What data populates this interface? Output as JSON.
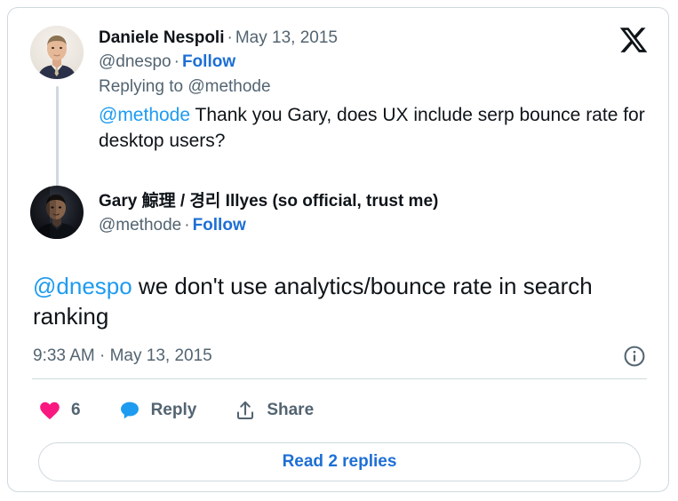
{
  "card": {
    "brand_logo": "x-logo",
    "border_color": "#cfd9de"
  },
  "parent_tweet": {
    "author": {
      "display_name": "Daniele Nespoli",
      "handle": "@dnespo",
      "avatar": "daniele-nespoli-avatar"
    },
    "separator": "·",
    "date": "May 13, 2015",
    "follow_label": "Follow",
    "replying_to": "Replying to @methode",
    "body_mention": "@methode",
    "body_text": " Thank you Gary, does UX include serp bounce rate for desktop users?"
  },
  "main_tweet": {
    "author": {
      "display_name": "Gary 鯨理 / 경리 Illyes (so official, trust me)",
      "handle": "@methode",
      "avatar": "gary-illyes-avatar"
    },
    "separator": "·",
    "follow_label": "Follow",
    "body_mention": "@dnespo",
    "body_text": " we don't use analytics/bounce rate in search ranking",
    "timestamp": "9:33 AM · May 13, 2015",
    "info_icon": "info-circle-icon"
  },
  "actions": {
    "like": {
      "icon": "heart-icon",
      "count": "6",
      "color": "#f91880"
    },
    "reply": {
      "icon": "speech-bubble-icon",
      "label": "Reply",
      "color": "#1d9bf0"
    },
    "share": {
      "icon": "share-upload-icon",
      "label": "Share",
      "color": "#536471"
    }
  },
  "footer": {
    "read_replies_label": "Read 2 replies",
    "link_color": "#1d6fd4"
  }
}
